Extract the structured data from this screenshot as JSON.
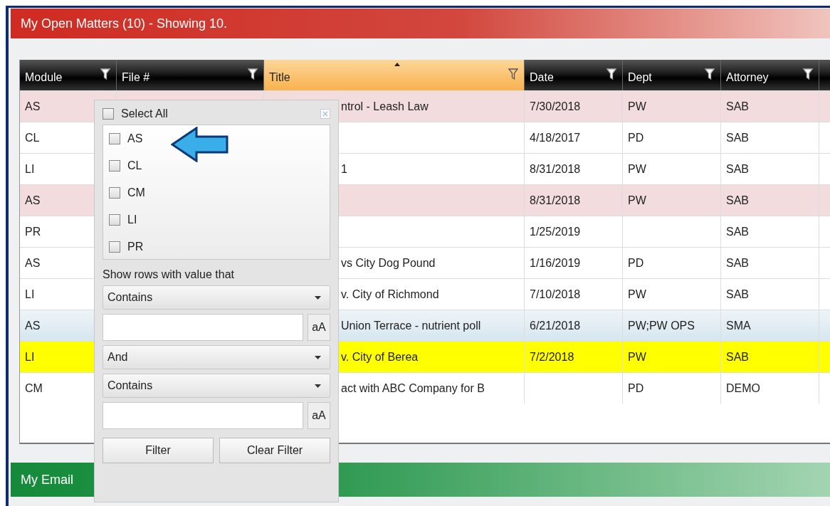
{
  "panel_title": "My Open Matters (10) - Showing 10.",
  "table": {
    "columns": [
      {
        "label": "Module",
        "sorted": false
      },
      {
        "label": "File #",
        "sorted": false
      },
      {
        "label": "Title",
        "sorted": true
      },
      {
        "label": "Date",
        "sorted": false
      },
      {
        "label": "Dept",
        "sorted": false
      },
      {
        "label": "Attorney",
        "sorted": false
      }
    ],
    "rows": [
      {
        "kind": "overdue",
        "selected": false,
        "module": "AS",
        "title": "ntrol - Leash Law",
        "date": "7/30/2018",
        "dept": "PW",
        "attorney": "SAB"
      },
      {
        "kind": "normal",
        "selected": false,
        "module": "CL",
        "title": "",
        "date": "4/18/2017",
        "dept": "PD",
        "attorney": "SAB"
      },
      {
        "kind": "normal",
        "selected": false,
        "module": "LI",
        "title": "1",
        "date": "8/31/2018",
        "dept": "PW",
        "attorney": "SAB"
      },
      {
        "kind": "overdue",
        "selected": false,
        "module": "AS",
        "title": "",
        "date": "8/31/2018",
        "dept": "PW",
        "attorney": "SAB"
      },
      {
        "kind": "normal",
        "selected": false,
        "module": "PR",
        "title": "",
        "date": "1/25/2019",
        "dept": "",
        "attorney": "SAB"
      },
      {
        "kind": "normal",
        "selected": false,
        "module": "AS",
        "title": "vs City Dog Pound",
        "date": "1/16/2019",
        "dept": "PD",
        "attorney": "SAB"
      },
      {
        "kind": "normal",
        "selected": false,
        "module": "LI",
        "title": "v. City of Richmond",
        "date": "7/10/2018",
        "dept": "PW",
        "attorney": "SAB"
      },
      {
        "kind": "normal",
        "selected": true,
        "module": "AS",
        "title": "Union Terrace - nutrient poll",
        "date": "6/21/2018",
        "dept": "PW;PW OPS",
        "attorney": "SMA"
      },
      {
        "kind": "flagged",
        "selected": false,
        "module": "LI",
        "title": "v. City of Berea",
        "date": "7/2/2018",
        "dept": "PW",
        "attorney": "SAB"
      },
      {
        "kind": "normal",
        "selected": false,
        "module": "CM",
        "title": "act with ABC Company for B",
        "date": "",
        "dept": "PD",
        "attorney": "DEMO"
      }
    ]
  },
  "filter_popup": {
    "select_all": {
      "label": "Select All",
      "checked": false
    },
    "values": [
      {
        "label": "AS",
        "checked": false
      },
      {
        "label": "CL",
        "checked": false
      },
      {
        "label": "CM",
        "checked": false
      },
      {
        "label": "LI",
        "checked": false
      },
      {
        "label": "PR",
        "checked": false
      }
    ],
    "condition_label": "Show rows with value that",
    "operator_1": "Contains",
    "match_case_1": "aA",
    "join": "And",
    "operator_2": "Contains",
    "match_case_2": "aA",
    "buttons": [
      "Filter",
      "Clear Filter"
    ]
  },
  "email_panel_title": "My Email"
}
